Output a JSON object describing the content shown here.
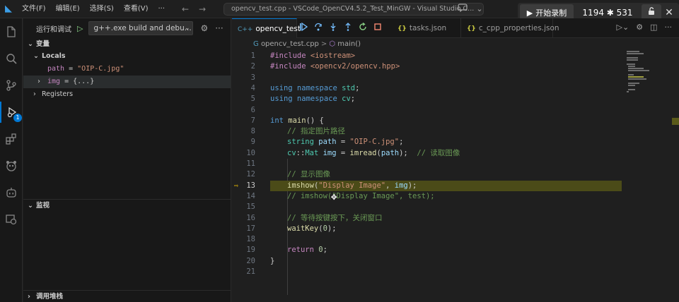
{
  "titlebar": {
    "logo": "◣",
    "menus": [
      "文件(F)",
      "编辑(E)",
      "选择(S)",
      "查看(V)"
    ],
    "more": "···",
    "back": "←",
    "forward": "→",
    "search_text": "opencv_test.cpp - VSCode_OpenCV4.5.2_Test_MinGW - Visual Studio C..."
  },
  "recorder": {
    "start_label": "开始录制",
    "play_glyph": "▶",
    "size": "1194 ✱ 531",
    "lock_glyph": "🔓",
    "close_glyph": "✕"
  },
  "activitybar": {
    "icons": [
      "explorer-icon",
      "search-icon",
      "source-control-icon",
      "run-debug-icon",
      "extensions-icon",
      "panda-icon",
      "robot-icon",
      "remote-icon"
    ],
    "debug_badge": "1"
  },
  "sidebar": {
    "title": "运行和调试",
    "play": "▷",
    "config": "g++.exe build and debu...",
    "config_arrow": "⌄",
    "gear": "⚙",
    "more": "···",
    "variables_header": "变量",
    "locals_label": "Locals",
    "vars": [
      {
        "name": "path",
        "eq": " = ",
        "value": "\"OIP-C.jpg\""
      },
      {
        "name": "img",
        "eq": " = ",
        "value": "{...}"
      }
    ],
    "registers_label": "Registers",
    "watch_header": "监视",
    "callstack_header": "调用堆栈"
  },
  "editor": {
    "tabs": [
      {
        "label": "opencv_test",
        "icon": "C++"
      },
      {
        "label": "tasks.json",
        "icon": "{}"
      },
      {
        "label": "c_cpp_properties.json",
        "icon": "{}"
      }
    ],
    "debug_buttons": [
      "continue-icon",
      "step-over-icon",
      "step-into-icon",
      "step-out-icon",
      "restart-icon",
      "stop-icon"
    ],
    "breadcrumb": {
      "file": "opencv_test.cpp",
      "sep": ">",
      "symbol": "main()"
    },
    "current_line": 13,
    "line_numbers": [
      "1",
      "2",
      "3",
      "4",
      "5",
      "6",
      "7",
      "8",
      "9",
      "10",
      "11",
      "12",
      "13",
      "14",
      "15",
      "16",
      "17",
      "18",
      "19",
      "20",
      "21"
    ],
    "code": {
      "l1_pp": "#include",
      "l1_inc": " <iostream>",
      "l2_pp": "#include",
      "l2_inc": " <opencv2/opencv.hpp>",
      "l4_kw1": "using",
      "l4_kw2": " namespace",
      "l4_ns": " std",
      "l4_p": ";",
      "l5_kw1": "using",
      "l5_kw2": " namespace",
      "l5_ns": " cv",
      "l5_p": ";",
      "l7_kw": "int",
      "l7_fn": " main",
      "l7_p": "() {",
      "l8_cm": "// 指定图片路径",
      "l9_ns": "string",
      "l9_id": " path",
      "l9_p": " = ",
      "l9_str": "\"OIP-C.jpg\"",
      "l9_e": ";",
      "l10_ns1": "cv",
      "l10_p1": "::",
      "l10_ns2": "Mat",
      "l10_id": " img",
      "l10_p2": " = ",
      "l10_fn": "imread",
      "l10_p3": "(",
      "l10_arg": "path",
      "l10_p4": ");  ",
      "l10_cm": "// 读取图像",
      "l12_cm": "// 显示图像",
      "l13_fn": "imshow",
      "l13_p1": "(",
      "l13_str": "\"Display Image\"",
      "l13_p2": ", ",
      "l13_id": "img",
      "l13_p3": ");",
      "l14_cm": "// imshow(\"Display Image\", test);",
      "l16_cm": "// 等待按键按下，关闭窗口",
      "l17_fn": "waitKey",
      "l17_p1": "(",
      "l17_num": "0",
      "l17_p2": ");",
      "l19_kw": "return",
      "l19_num": " 0",
      "l19_p": ";",
      "l20_p": "}"
    }
  },
  "colors": {
    "accent": "#0078d4",
    "highlight_line": "#4b4b18",
    "breakpoint_arrow": "#ffcc00"
  }
}
